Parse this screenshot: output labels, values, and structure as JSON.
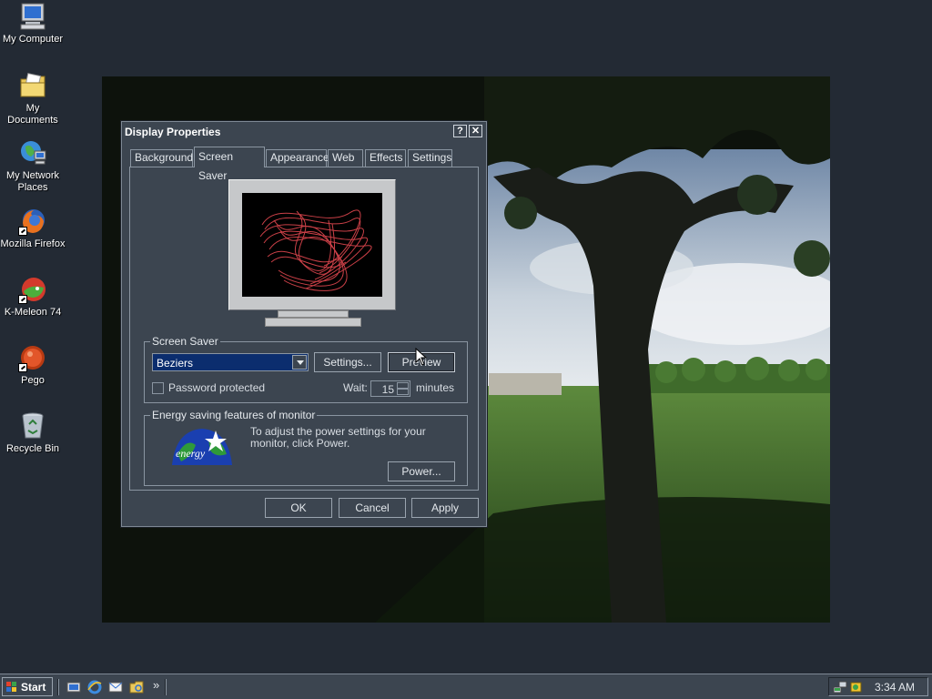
{
  "desktop": {
    "icons": [
      {
        "label": "My Computer",
        "icon": "my-computer-icon"
      },
      {
        "label": "My Documents",
        "icon": "my-documents-icon"
      },
      {
        "label": "My Network Places",
        "icon": "network-places-icon"
      },
      {
        "label": "Mozilla Firefox",
        "icon": "firefox-icon"
      },
      {
        "label": "K-Meleon 74",
        "icon": "k-meleon-icon"
      },
      {
        "label": "Pego",
        "icon": "pego-icon"
      },
      {
        "label": "Recycle Bin",
        "icon": "recycle-bin-icon"
      }
    ]
  },
  "dialog": {
    "title": "Display Properties",
    "help_glyph": "?",
    "close_glyph": "✕",
    "tabs": [
      {
        "label": "Background"
      },
      {
        "label": "Screen Saver",
        "active": true
      },
      {
        "label": "Appearance"
      },
      {
        "label": "Web"
      },
      {
        "label": "Effects"
      },
      {
        "label": "Settings"
      }
    ],
    "screen_saver": {
      "group_label": "Screen Saver",
      "selected": "Beziers",
      "settings_label": "Settings...",
      "preview_label": "Preview",
      "password_label": "Password protected",
      "password_checked": false,
      "wait_label": "Wait:",
      "wait_value": "15",
      "wait_unit": "minutes"
    },
    "energy": {
      "group_label": "Energy saving features of monitor",
      "text": "To adjust the power settings for your monitor, click Power.",
      "power_label": "Power...",
      "logo_text": "energy"
    },
    "ok_label": "OK",
    "cancel_label": "Cancel",
    "apply_label": "Apply"
  },
  "taskbar": {
    "start_label": "Start",
    "overflow_glyph": "»",
    "clock": "3:34 AM"
  },
  "colors": {
    "desktop_bg": "#232a34",
    "dialog_bg": "#3c4550",
    "selection": "#0b2d6e",
    "bezier": "#e0474f"
  }
}
